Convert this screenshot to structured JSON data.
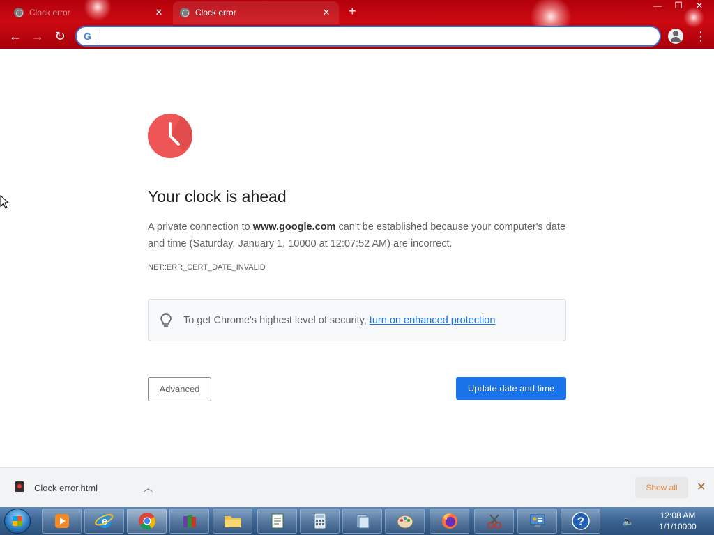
{
  "browser": {
    "tabs": [
      {
        "title": "Clock error",
        "active": false
      },
      {
        "title": "Clock error",
        "active": true
      }
    ],
    "new_tab_symbol": "+",
    "window_buttons": [
      "—",
      "❐",
      "✕"
    ],
    "omnibox": {
      "value": "",
      "placeholder": ""
    },
    "accent_color": "#c00010"
  },
  "error_page": {
    "heading": "Your clock is ahead",
    "para_prefix": "A private connection to ",
    "para_domain": "www.google.com",
    "para_suffix": " can't be established because your computer's date and time (Saturday, January 1, 10000 at 12:07:52 AM) are incorrect.",
    "error_code": "NET::ERR_CERT_DATE_INVALID",
    "security_text": "To get Chrome's highest level of security, ",
    "security_link": "turn on enhanced protection",
    "advanced_button": "Advanced",
    "update_button": "Update date and time",
    "icon_color": "#ee5555",
    "primary_color": "#1a73e8"
  },
  "download_bar": {
    "file_name": "Clock error.html",
    "show_all": "Show all",
    "close_symbol": "✕"
  },
  "taskbar": {
    "time": "12:08 AM",
    "date": "1/1/10000",
    "items": [
      "media-player",
      "internet-explorer",
      "chrome",
      "winrar",
      "file-explorer",
      "notepad",
      "calculator",
      "file-manager",
      "paint",
      "firefox",
      "snipping-tool",
      "control-panel",
      "help"
    ]
  }
}
